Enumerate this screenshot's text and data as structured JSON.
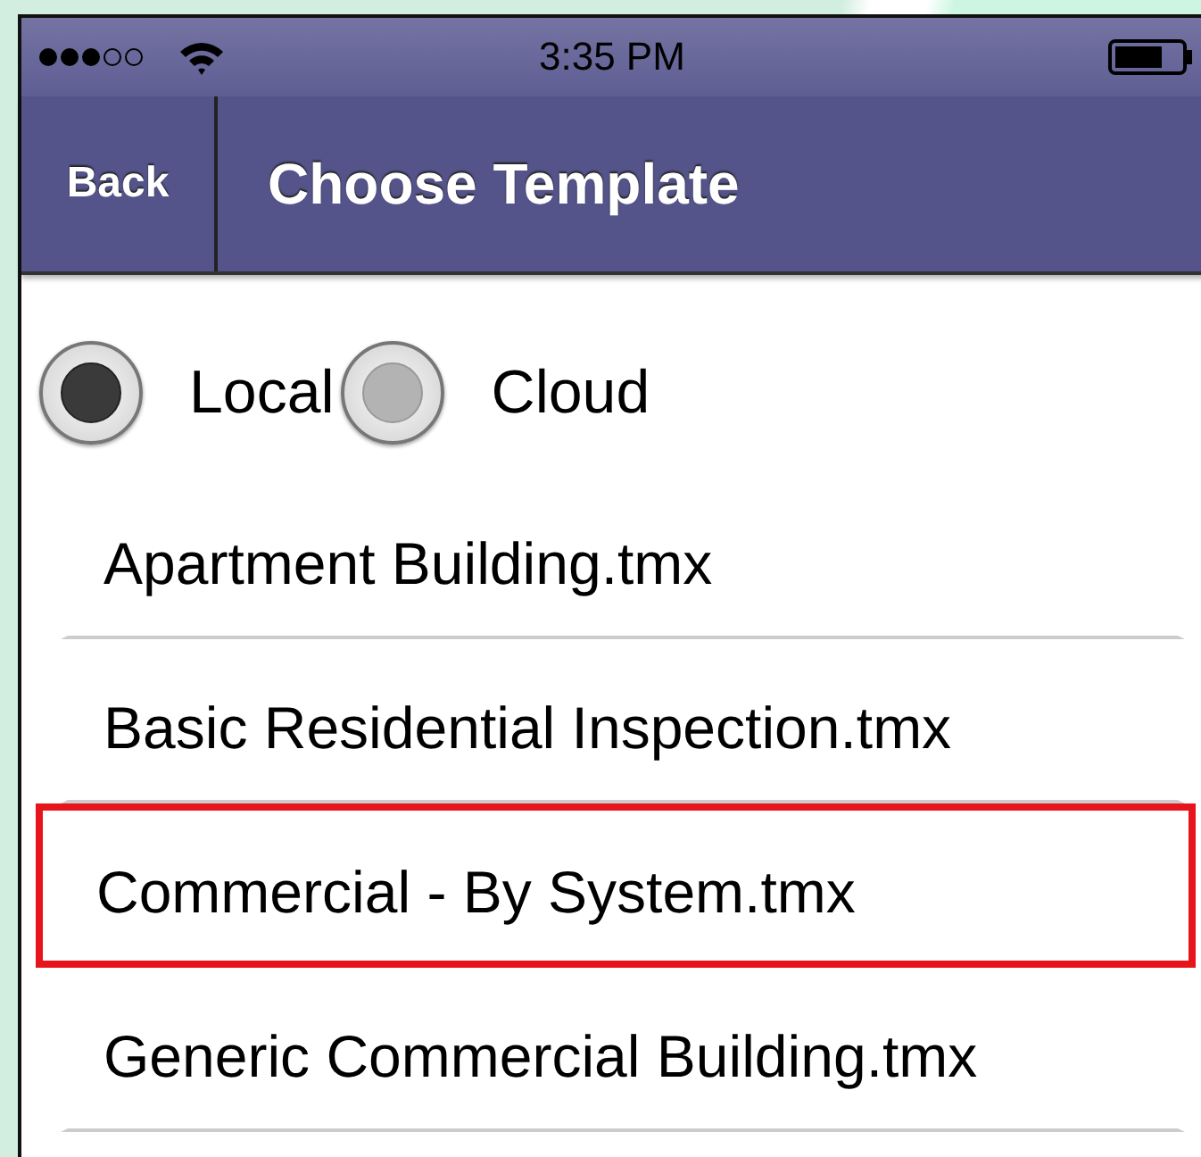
{
  "status_bar": {
    "signal_dots": [
      {
        "on": true
      },
      {
        "on": true
      },
      {
        "on": true
      },
      {
        "on": false
      },
      {
        "on": false
      }
    ],
    "time": "3:35 PM"
  },
  "nav_bar": {
    "back": "Back",
    "title": "Choose Template"
  },
  "source": [
    {
      "label": "Local",
      "selected": true
    },
    {
      "label": "Cloud",
      "selected": false
    }
  ],
  "templates": [
    {
      "name": "Apartment Building.tmx",
      "selected": false
    },
    {
      "name": "Basic Residential Inspection.tmx",
      "selected": false
    },
    {
      "name": "Commercial - By System.tmx",
      "selected": true
    },
    {
      "name": "Generic Commercial Building.tmx",
      "selected": false
    }
  ]
}
